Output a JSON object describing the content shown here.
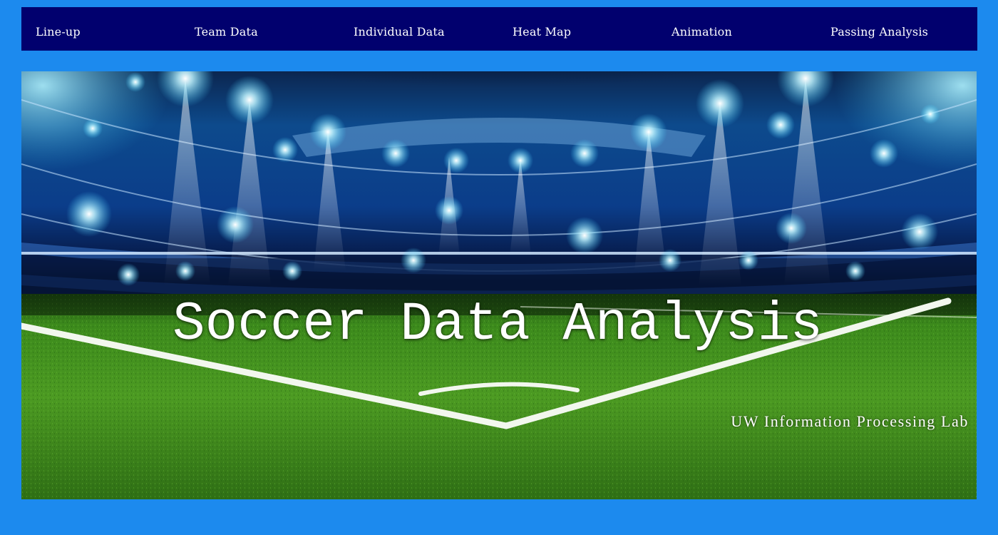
{
  "nav": {
    "items": [
      {
        "id": "lineup",
        "label": "Line-up"
      },
      {
        "id": "team-data",
        "label": "Team Data"
      },
      {
        "id": "individual-data",
        "label": "Individual Data"
      },
      {
        "id": "heat-map",
        "label": "Heat Map"
      },
      {
        "id": "animation",
        "label": "Animation"
      },
      {
        "id": "passing-analysis",
        "label": "Passing Analysis"
      }
    ]
  },
  "hero": {
    "title": "Soccer Data Analysis",
    "subtitle": "UW Information Processing Lab",
    "image_description_icon": "stadium-night-image"
  },
  "colors": {
    "page_background": "#1c8aee",
    "nav_background": "#01006e",
    "nav_text": "#ffffff",
    "hero_text": "#ffffff",
    "grass": "#3f8f1e",
    "stadium_blue": "#0a4fa8"
  }
}
